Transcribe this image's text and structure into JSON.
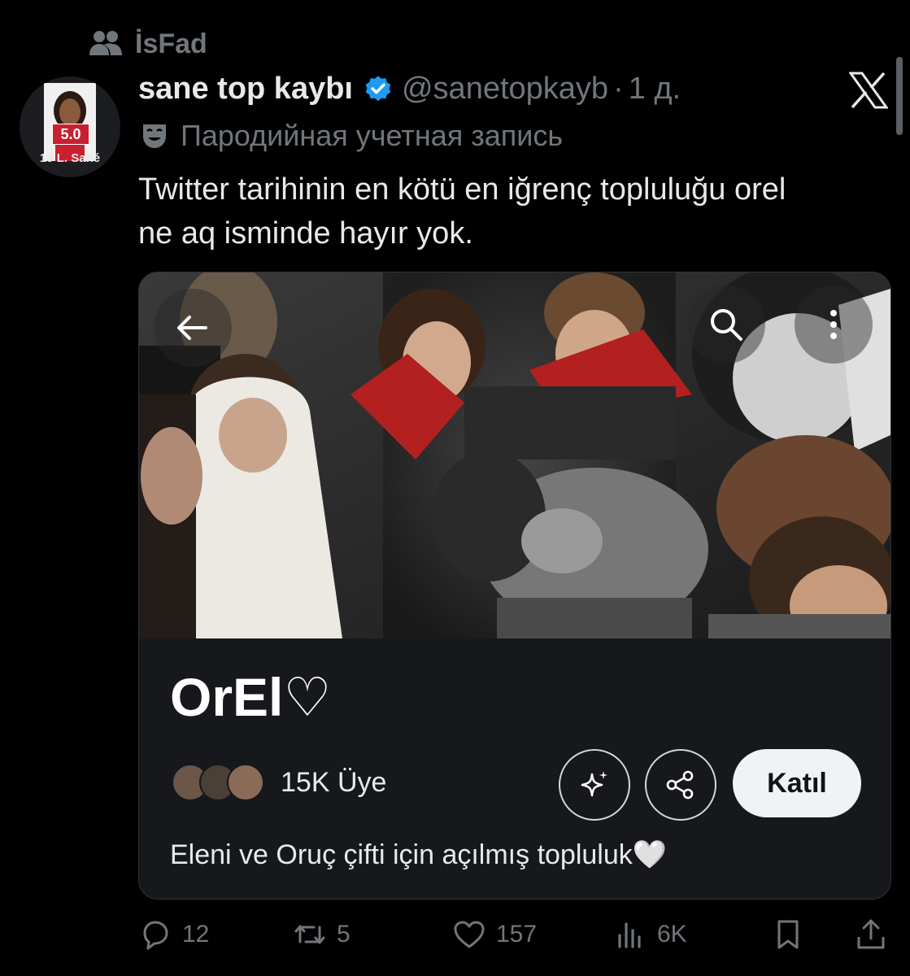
{
  "repost": {
    "label": "İsFad",
    "icon": "people-icon"
  },
  "author": {
    "avatar_rating": "5.0",
    "avatar_card_name": "19 L. Sané",
    "display_name": "sane top kaybı",
    "handle": "@sanetopkayb",
    "separator": "·",
    "time": "1 д.",
    "verified_color": "#1d9bf0",
    "parody_label": "Пародийная учетная запись"
  },
  "tweet": {
    "text_line1": "Twitter tarihinin en kötü en iğrenç topluluğu orel",
    "text_line2": "ne aq isminde hayır yok."
  },
  "community": {
    "name": "OrEl♡",
    "members": "15K Üye",
    "join_label": "Katıl",
    "description": "Eleni ve Oruç çifti için açılmış topluluk🤍",
    "banner_icons": [
      "back-arrow-icon",
      "search-icon",
      "more-vertical-icon"
    ],
    "action_icons": [
      "sparkle-icon",
      "share-icon"
    ]
  },
  "actions": {
    "replies": "12",
    "reposts": "5",
    "likes": "157",
    "views": "6K"
  },
  "colors": {
    "background": "#000000",
    "text": "#e7e9ea",
    "muted": "#71767b",
    "card": "#16181c",
    "join_button": "#eff3f4"
  }
}
